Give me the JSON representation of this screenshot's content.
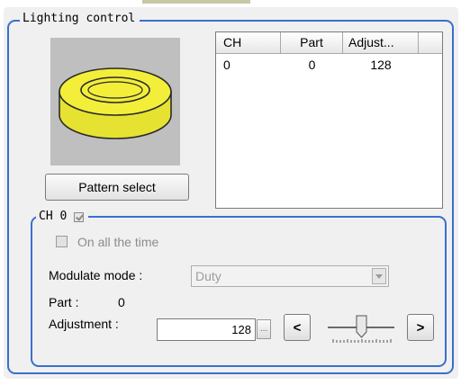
{
  "groups": {
    "lighting_control_title": "Lighting control",
    "channel_title": "CH 0"
  },
  "buttons": {
    "pattern_select": "Pattern select",
    "ellipsis": "...",
    "decrease": "<",
    "increase": ">"
  },
  "table": {
    "columns": [
      "CH",
      "Part",
      "Adjust..."
    ],
    "rows": [
      {
        "ch": "0",
        "part": "0",
        "adjust": "128"
      }
    ]
  },
  "channel": {
    "enabled_checked": true,
    "on_all_the_time_label": "On all the time",
    "on_all_the_time_checked": false,
    "modulate_mode_label": "Modulate mode :",
    "modulate_mode_value": "Duty",
    "part_label": "Part :",
    "part_value": "0",
    "adjustment_label": "Adjustment :",
    "adjustment_value": "128"
  },
  "icons": {
    "ring_light": "ring-light-illustration",
    "dropdown": "chevron-down-icon",
    "slider": "slider-thumb"
  },
  "colors": {
    "group_border": "#3a6fd0",
    "panel_bg": "#f0f0f0",
    "ring_fill": "#f2ee3a",
    "image_bg": "#bfbfbf"
  }
}
